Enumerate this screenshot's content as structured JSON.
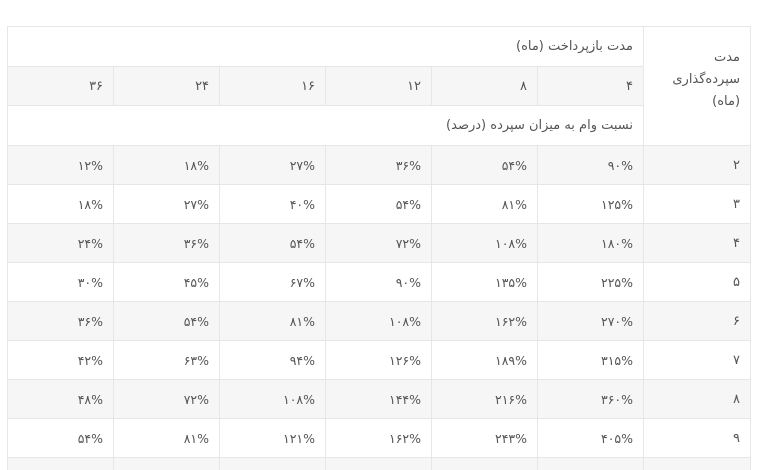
{
  "table": {
    "deposit_header": [
      "مدت",
      "سپرده‌گذاری",
      "(ماه)"
    ],
    "repay_caption": "مدت بازپرداخت (ماه)",
    "repay_months": [
      "۴",
      "۸",
      "۱۲",
      "۱۶",
      "۲۴",
      "۳۶"
    ],
    "ratio_caption": "نسبت وام به میزان سپرده (درصد)",
    "rows": [
      {
        "deposit": "۲",
        "values": [
          "۹۰%",
          "۵۴%",
          "۳۶%",
          "۲۷%",
          "۱۸%",
          "۱۲%"
        ]
      },
      {
        "deposit": "۳",
        "values": [
          "۱۲۵%",
          "۸۱%",
          "۵۴%",
          "۴۰%",
          "۲۷%",
          "۱۸%"
        ]
      },
      {
        "deposit": "۴",
        "values": [
          "۱۸۰%",
          "۱۰۸%",
          "۷۲%",
          "۵۴%",
          "۳۶%",
          "۲۴%"
        ]
      },
      {
        "deposit": "۵",
        "values": [
          "۲۲۵%",
          "۱۳۵%",
          "۹۰%",
          "۶۷%",
          "۴۵%",
          "۳۰%"
        ]
      },
      {
        "deposit": "۶",
        "values": [
          "۲۷۰%",
          "۱۶۲%",
          "۱۰۸%",
          "۸۱%",
          "۵۴%",
          "۳۶%"
        ]
      },
      {
        "deposit": "۷",
        "values": [
          "۳۱۵%",
          "۱۸۹%",
          "۱۲۶%",
          "۹۴%",
          "۶۳%",
          "۴۲%"
        ]
      },
      {
        "deposit": "۸",
        "values": [
          "۳۶۰%",
          "۲۱۶%",
          "۱۴۴%",
          "۱۰۸%",
          "۷۲%",
          "۴۸%"
        ]
      },
      {
        "deposit": "۹",
        "values": [
          "۴۰۵%",
          "۲۴۳%",
          "۱۶۲%",
          "۱۲۱%",
          "۸۱%",
          "۵۴%"
        ]
      }
    ]
  }
}
